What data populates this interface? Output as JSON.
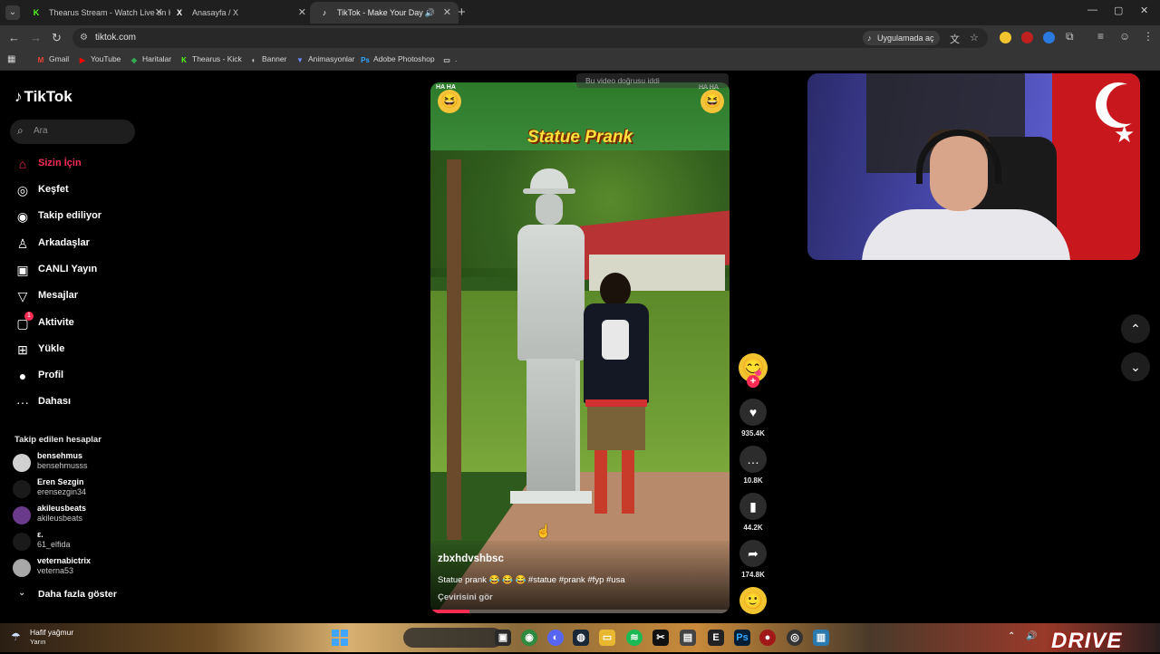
{
  "browser": {
    "tabs": [
      {
        "title": "Thearus Stream - Watch Live on Kick",
        "favicon": "kick-icon",
        "color": "#53fc18"
      },
      {
        "title": "Anasayfa / X",
        "favicon": "x-icon",
        "color": "#ffffff"
      },
      {
        "title": "TikTok - Make Your Day",
        "favicon": "tiktok-icon",
        "color": "#ffffff",
        "active": true,
        "playing_audio": true
      }
    ],
    "url": "tiktok.com",
    "open_in_app_label": "Uygulamada aç",
    "bookmarks": [
      {
        "label": "Gmail",
        "icon": "gmail-icon",
        "color": "#ea4335"
      },
      {
        "label": "YouTube",
        "icon": "youtube-icon",
        "color": "#ff0000"
      },
      {
        "label": "Haritalar",
        "icon": "maps-icon",
        "color": "#34a853"
      },
      {
        "label": "Thearus - Kick",
        "icon": "kick-icon",
        "color": "#53fc18"
      },
      {
        "label": "Banner",
        "icon": "banner-icon",
        "color": "#cccccc"
      },
      {
        "label": "Animasyonlar",
        "icon": "animations-icon",
        "color": "#6a8aff"
      },
      {
        "label": "Adobe Photoshop",
        "icon": "photoshop-icon",
        "color": "#31a8ff"
      },
      {
        "label": ".",
        "icon": "folder-icon",
        "color": "#cccccc"
      }
    ]
  },
  "tiktok": {
    "logo": "TikTok",
    "search_placeholder": "Ara",
    "nav": [
      {
        "label": "Sizin İçin",
        "icon": "home-icon",
        "glyph": "⌂",
        "active": true
      },
      {
        "label": "Keşfet",
        "icon": "compass-icon",
        "glyph": "◎"
      },
      {
        "label": "Takip ediliyor",
        "icon": "following-avatar-icon",
        "glyph": "◉"
      },
      {
        "label": "Arkadaşlar",
        "icon": "friends-icon",
        "glyph": "♙"
      },
      {
        "label": "CANLI Yayın",
        "icon": "live-icon",
        "glyph": "▣"
      },
      {
        "label": "Mesajlar",
        "icon": "messages-icon",
        "glyph": "▽"
      },
      {
        "label": "Aktivite",
        "icon": "activity-icon",
        "glyph": "▢",
        "badge": "1"
      },
      {
        "label": "Yükle",
        "icon": "upload-icon",
        "glyph": "⊞"
      },
      {
        "label": "Profil",
        "icon": "profile-icon",
        "glyph": "●"
      },
      {
        "label": "Dahası",
        "icon": "more-icon",
        "glyph": "···"
      }
    ],
    "followed_title": "Takip edilen hesaplar",
    "followed_accounts": [
      {
        "name": "bensehmus",
        "handle": "bensehmusss",
        "color": "#d0d0d0"
      },
      {
        "name": "Eren Sezgin",
        "handle": "erensezgin34",
        "color": "#1a1a1a"
      },
      {
        "name": "akileusbeats",
        "handle": "akileusbeats",
        "color": "#6a3a8a"
      },
      {
        "name": "ε.",
        "handle": "61_elfida",
        "color": "#1a1a1a"
      },
      {
        "name": "veternabictrix",
        "handle": "veterna53",
        "color": "#a8a8a8"
      }
    ],
    "show_more_label": "Daha fazla göster",
    "video": {
      "title_overlay": "Statue Prank",
      "corner_text": "HA HA",
      "hidden_tag": "Bu video doğrusu iddi",
      "username": "zbxhdvshbsc",
      "caption": "Statue prank 😂 😂 😂 #statue #prank #fyp #usa",
      "translation_label": "Çevirisini gör",
      "progress": 0.13
    },
    "actions": [
      {
        "icon": "like-icon",
        "glyph": "♥",
        "count": "935.4K"
      },
      {
        "icon": "comment-icon",
        "glyph": "…",
        "count": "10.8K"
      },
      {
        "icon": "bookmark-icon",
        "glyph": "▮",
        "count": "44.2K"
      },
      {
        "icon": "share-icon",
        "glyph": "➦",
        "count": "174.8K"
      }
    ]
  },
  "taskbar": {
    "weather_text": "Hafif yağmur",
    "weather_sub": "Yarın",
    "watermark": "DRIVE"
  },
  "colors": {
    "accent": "#fe2c55",
    "background": "#000000"
  }
}
